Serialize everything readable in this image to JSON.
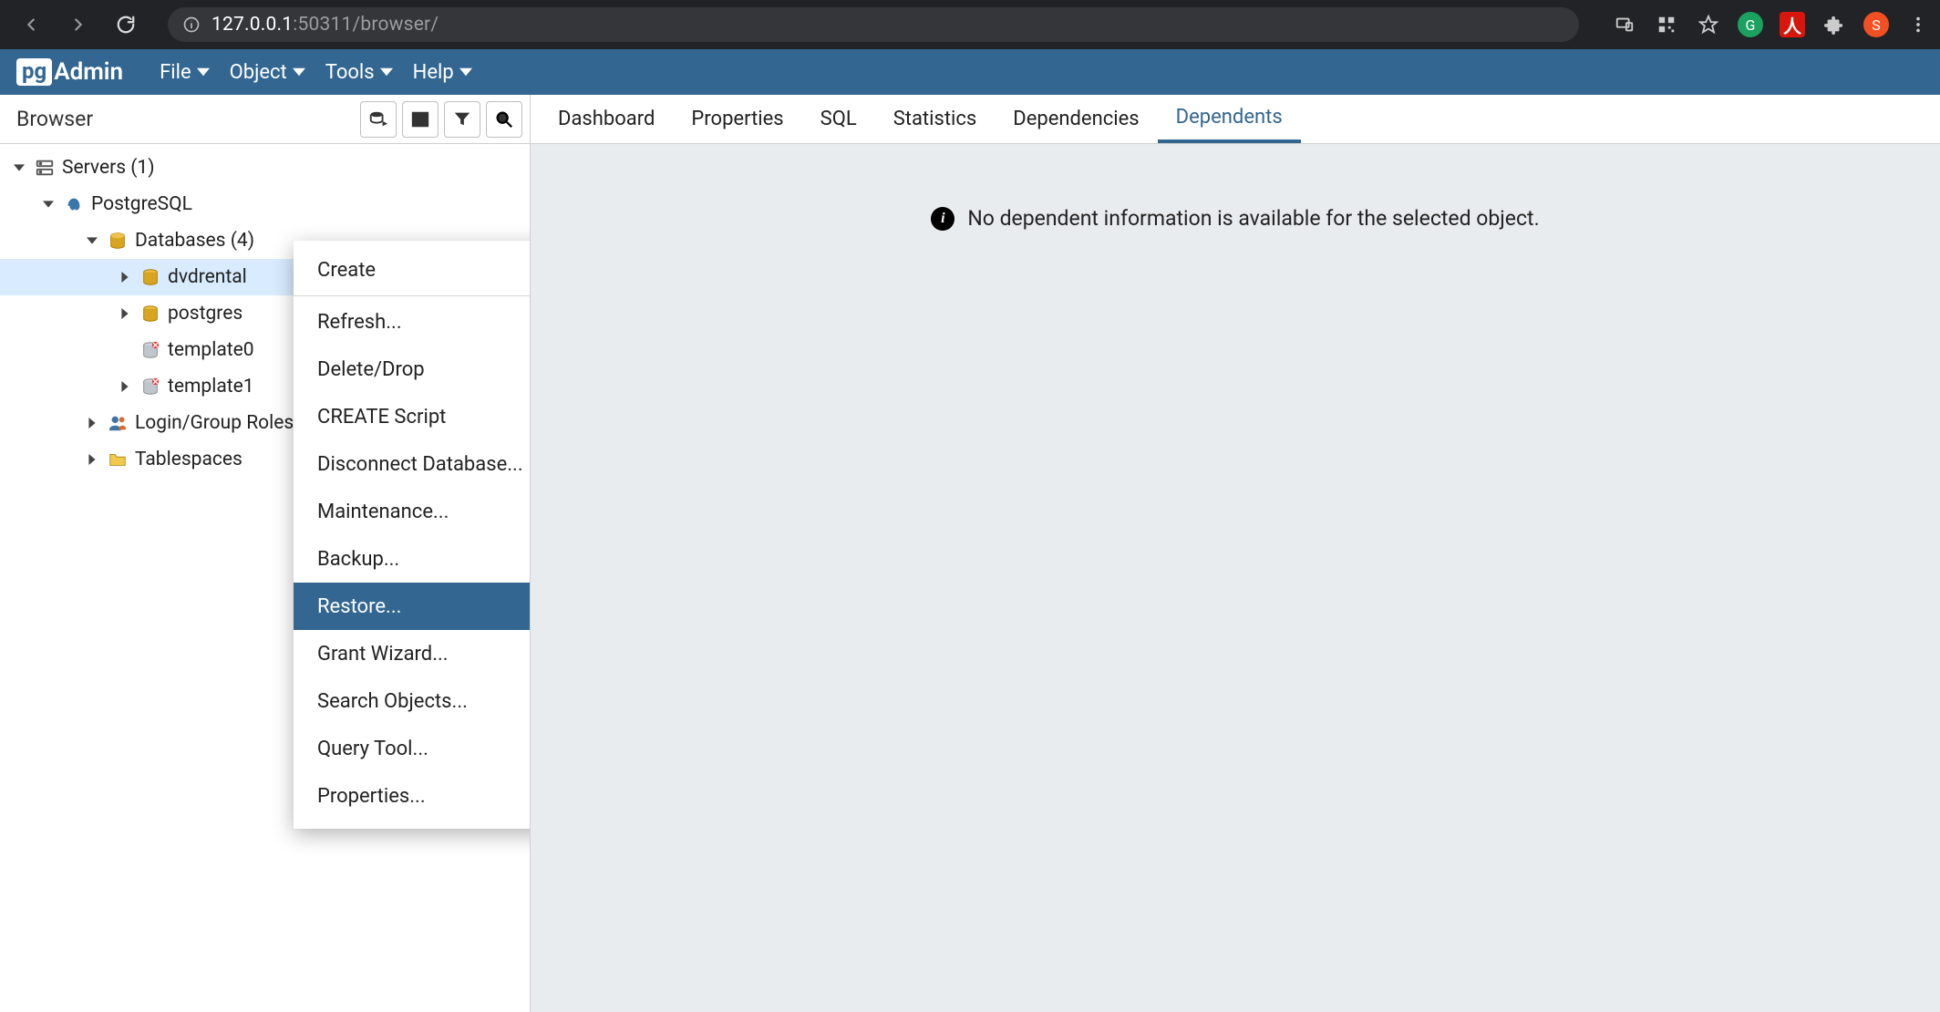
{
  "browser": {
    "url_host": "127.0.0.1",
    "url_rest": ":50311/browser/",
    "profile_letter": "S"
  },
  "menubar": {
    "logo_pg": "pg",
    "logo_admin": "Admin",
    "items": [
      "File",
      "Object",
      "Tools",
      "Help"
    ]
  },
  "sidebar": {
    "title": "Browser"
  },
  "tree": {
    "servers_label": "Servers (1)",
    "pg_label": "PostgreSQL",
    "databases_label": "Databases (4)",
    "db0": "dvdrental",
    "db1": "postgres",
    "db2": "template0",
    "db3": "template1",
    "login_label": "Login/Group Roles",
    "ts_label": "Tablespaces"
  },
  "tabs": {
    "items": [
      "Dashboard",
      "Properties",
      "SQL",
      "Statistics",
      "Dependencies",
      "Dependents"
    ],
    "active_index": 5
  },
  "content": {
    "empty_message": "No dependent information is available for the selected object."
  },
  "context_menu": {
    "create": "Create",
    "items": [
      "Refresh...",
      "Delete/Drop",
      "CREATE Script",
      "Disconnect Database...",
      "Maintenance...",
      "Backup...",
      "Restore...",
      "Grant Wizard...",
      "Search Objects...",
      "Query Tool...",
      "Properties..."
    ],
    "highlighted_index": 6
  }
}
